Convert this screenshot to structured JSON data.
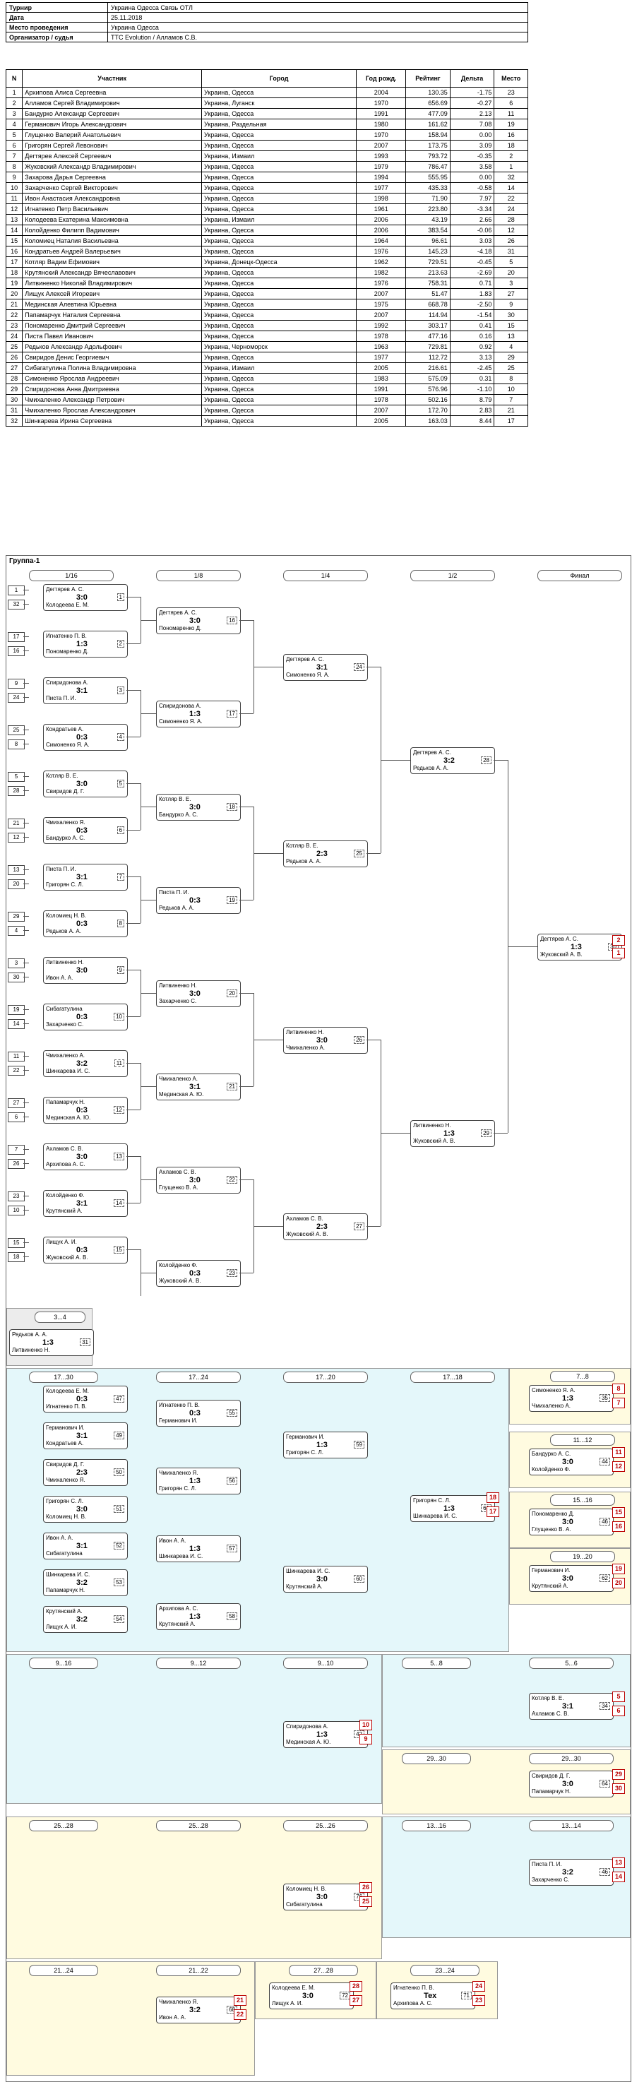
{
  "info": [
    {
      "k": "Турнир",
      "v": "Украина Одесса Связь ОТЛ"
    },
    {
      "k": "Дата",
      "v": "25.11.2018"
    },
    {
      "k": "Место проведения",
      "v": "Украина Одесса"
    },
    {
      "k": "Организатор / судья",
      "v": "TTC Evolution / Алламов С.В."
    }
  ],
  "players_header": [
    "N",
    "Участник",
    "Город",
    "Год рожд.",
    "Рейтинг",
    "Дельта",
    "Место"
  ],
  "players": [
    [
      "1",
      "Архипова Алиса Сергеевна",
      "Украина, Одесса",
      "2004",
      "130.35",
      "-1.75",
      "23"
    ],
    [
      "2",
      "Алламов Сергей Владимирович",
      "Украина, Луганск",
      "1970",
      "656.69",
      "-0.27",
      "6"
    ],
    [
      "3",
      "Бандурко Александр Сергеевич",
      "Украина, Одесса",
      "1991",
      "477.09",
      "2.13",
      "11"
    ],
    [
      "4",
      "Германович Игорь Александрович",
      "Украина, Раздельная",
      "1980",
      "161.62",
      "7.08",
      "19"
    ],
    [
      "5",
      "Глущенко Валерий Анатольевич",
      "Украина, Одесса",
      "1970",
      "158.94",
      "0.00",
      "16"
    ],
    [
      "6",
      "Григорян Сергей Левонович",
      "Украина, Одесса",
      "2007",
      "173.75",
      "3.09",
      "18"
    ],
    [
      "7",
      "Дегтярев Алексей Сергеевич",
      "Украина, Измаил",
      "1993",
      "793.72",
      "-0.35",
      "2"
    ],
    [
      "8",
      "Жуковский Александр Владимирович",
      "Украина, Одесса",
      "1979",
      "786.47",
      "3.58",
      "1"
    ],
    [
      "9",
      "Захарова Дарья Сергеевна",
      "Украина, Одесса",
      "1994",
      "555.95",
      "0.00",
      "32"
    ],
    [
      "10",
      "Захарченко Сергей Викторович",
      "Украина, Одесса",
      "1977",
      "435.33",
      "-0.58",
      "14"
    ],
    [
      "11",
      "Ивон Анастасия Александровна",
      "Украина, Одесса",
      "1998",
      "71.90",
      "7.97",
      "22"
    ],
    [
      "12",
      "Игнатенко Петр Васильевич",
      "Украина, Одесса",
      "1961",
      "223.80",
      "-3.34",
      "24"
    ],
    [
      "13",
      "Колодеева Екатерина Максимовна",
      "Украина, Измаил",
      "2006",
      "43.19",
      "2.66",
      "28"
    ],
    [
      "14",
      "Колойденко Филипп Вадимович",
      "Украина, Одесса",
      "2006",
      "383.54",
      "-0.06",
      "12"
    ],
    [
      "15",
      "Коломиец Наталия Васильевна",
      "Украина, Одесса",
      "1964",
      "96.61",
      "3.03",
      "26"
    ],
    [
      "16",
      "Кондратьев Андрей Валерьевич",
      "Украина, Одесса",
      "1976",
      "145.23",
      "-4.18",
      "31"
    ],
    [
      "17",
      "Котляр Вадим Ефимович",
      "Украина, Донецк-Одесса",
      "1962",
      "729.51",
      "-0.45",
      "5"
    ],
    [
      "18",
      "Крутянский Александр Вячеславович",
      "Украина, Одесса",
      "1982",
      "213.63",
      "-2.69",
      "20"
    ],
    [
      "19",
      "Литвиненко Николай Владимирович",
      "Украина, Одесса",
      "1976",
      "758.31",
      "0.71",
      "3"
    ],
    [
      "20",
      "Лищук Алексей Игоревич",
      "Украина, Одесса",
      "2007",
      "51.47",
      "1.83",
      "27"
    ],
    [
      "21",
      "Мединская Алевтина Юрьевна",
      "Украина, Одесса",
      "1975",
      "668.78",
      "-2.50",
      "9"
    ],
    [
      "22",
      "Папамарчук Наталия Сергеевна",
      "Украина, Одесса",
      "2007",
      "114.94",
      "-1.54",
      "30"
    ],
    [
      "23",
      "Пономаренко Дмитрий Сергеевич",
      "Украина, Одесса",
      "1992",
      "303.17",
      "0.41",
      "15"
    ],
    [
      "24",
      "Писта Павел Иванович",
      "Украина, Одесса",
      "1978",
      "477.16",
      "0.16",
      "13"
    ],
    [
      "25",
      "Редьков Александр Адольфович",
      "Украина, Черноморск",
      "1963",
      "729.81",
      "0.92",
      "4"
    ],
    [
      "26",
      "Свиридов Денис Георгиевич",
      "Украина, Одесса",
      "1977",
      "112.72",
      "3.13",
      "29"
    ],
    [
      "27",
      "Сибагатулина Полина Владимировна",
      "Украина, Измаил",
      "2005",
      "216.61",
      "-2.45",
      "25"
    ],
    [
      "28",
      "Симоненко Ярослав Андреевич",
      "Украина, Одесса",
      "1983",
      "575.09",
      "0.31",
      "8"
    ],
    [
      "29",
      "Спиридонова Анна Дмитриевна",
      "Украина, Одесса",
      "1991",
      "576.96",
      "-1.10",
      "10"
    ],
    [
      "30",
      "Чмихаленко Александр Петрович",
      "Украина, Одесса",
      "1978",
      "502.16",
      "8.79",
      "7"
    ],
    [
      "31",
      "Чмихаленко Ярослав Александрович",
      "Украина, Одесса",
      "2007",
      "172.70",
      "2.83",
      "21"
    ],
    [
      "32",
      "Шинкарева Ирина Сергеевна",
      "Украина, Одесса",
      "2005",
      "163.03",
      "8.44",
      "17"
    ]
  ],
  "group_title": "Группа-1",
  "rounds": [
    "1/16",
    "1/8",
    "1/4",
    "1/2",
    "Финал"
  ],
  "r16": [
    {
      "s1": "1",
      "s2": "32",
      "p1": "Дегтярев А. С.",
      "p2": "Колодеева Е. М.",
      "sc": "3:0",
      "no": "1",
      "out": "-48"
    },
    {
      "s1": "17",
      "s2": "16",
      "p1": "Игнатенко П. В.",
      "p2": "Пономаренко Д.",
      "sc": "1:3",
      "no": "2",
      "out": "-48"
    },
    {
      "s1": "9",
      "s2": "24",
      "p1": "Спиридонова А.",
      "p2": "Писта П. И.",
      "sc": "3:1",
      "no": "3",
      "out": "-49"
    },
    {
      "s1": "25",
      "s2": "8",
      "p1": "Кондратьев А.",
      "p2": "Симоненко Я. А.",
      "sc": "0:3",
      "no": "4",
      "out": "-49"
    },
    {
      "s1": "5",
      "s2": "28",
      "p1": "Котляр В. Е.",
      "p2": "Свиридов Д. Г.",
      "sc": "3:0",
      "no": "5",
      "out": "-50"
    },
    {
      "s1": "21",
      "s2": "12",
      "p1": "Чмихаленко Я.",
      "p2": "Бандурко А. С.",
      "sc": "0:3",
      "no": "6",
      "out": "-50"
    },
    {
      "s1": "13",
      "s2": "20",
      "p1": "Писта П. И.",
      "p2": "Григорян С. Л.",
      "sc": "3:1",
      "no": "7",
      "out": "-51"
    },
    {
      "s1": "29",
      "s2": "4",
      "p1": "Коломиец Н. В.",
      "p2": "Редьков А. А.",
      "sc": "0:3",
      "no": "8",
      "out": "-51"
    },
    {
      "s1": "3",
      "s2": "30",
      "p1": "Литвиненко Н.",
      "p2": "Ивон А. А.",
      "sc": "3:0",
      "no": "9",
      "out": "-52"
    },
    {
      "s1": "19",
      "s2": "14",
      "p1": "Сибагатулина",
      "p2": "Захарченко С.",
      "sc": "0:3",
      "no": "10",
      "out": "-52"
    },
    {
      "s1": "11",
      "s2": "22",
      "p1": "Чмихаленко А.",
      "p2": "Шинкарева И. С.",
      "sc": "3:2",
      "no": "11",
      "out": "-53"
    },
    {
      "s1": "27",
      "s2": "6",
      "p1": "Папамарчук Н.",
      "p2": "Мединская А. Ю.",
      "sc": "0:3",
      "no": "12",
      "out": "-53"
    },
    {
      "s1": "7",
      "s2": "26",
      "p1": "Ахламов С. В.",
      "p2": "Архипова А. С.",
      "sc": "3:0",
      "no": "13",
      "out": "-54"
    },
    {
      "s1": "23",
      "s2": "10",
      "p1": "Колойденко Ф.",
      "p2": "Крутянский А.",
      "sc": "3:1",
      "no": "14",
      "out": "-54"
    },
    {
      "s1": "15",
      "s2": "18",
      "p1": "Лищук А. И.",
      "p2": "Жуковский А. В.",
      "sc": "0:3",
      "no": "15",
      "out": "-55"
    }
  ],
  "r8": [
    {
      "p1": "Дегтярев А. С.",
      "p2": "Пономаренко Д.",
      "sc": "3:0",
      "no": "16",
      "out": "-36"
    },
    {
      "p1": "Спиридонова А.",
      "p2": "Симоненко Я. А.",
      "sc": "1:3",
      "no": "17",
      "out": "-36"
    },
    {
      "p1": "Котляр В. Е.",
      "p2": "Бандурко А. С.",
      "sc": "3:0",
      "no": "18",
      "out": "-37"
    },
    {
      "p1": "Писта П. И.",
      "p2": "Редьков А. А.",
      "sc": "0:3",
      "no": "19",
      "out": "-37"
    },
    {
      "p1": "Литвиненко Н.",
      "p2": "Захарченко С.",
      "sc": "3:0",
      "no": "20",
      "out": "-38"
    },
    {
      "p1": "Чмихаленко А.",
      "p2": "Мединская А. Ю.",
      "sc": "3:1",
      "no": "21",
      "out": "-38"
    },
    {
      "p1": "Ахламов С. В.",
      "p2": "Глущенко В. А.",
      "sc": "3:0",
      "no": "22",
      "out": "-39"
    },
    {
      "p1": "Колойденко Ф.",
      "p2": "Жуковский А. В.",
      "sc": "0:3",
      "no": "23",
      "out": "-39"
    }
  ],
  "r4": [
    {
      "p1": "Дегтярев А. С.",
      "p2": "Симоненко Я. А.",
      "sc": "3:1",
      "no": "24",
      "out": "-32"
    },
    {
      "p1": "Котляр В. Е.",
      "p2": "Редьков А. А.",
      "sc": "2:3",
      "no": "25",
      "out": "-32"
    },
    {
      "p1": "Литвиненко Н.",
      "p2": "Чмихаленко А.",
      "sc": "3:0",
      "no": "26",
      "out": "-33"
    },
    {
      "p1": "Ахламов С. В.",
      "p2": "Жуковский А. В.",
      "sc": "2:3",
      "no": "27",
      "out": "-33"
    }
  ],
  "r2": [
    {
      "p1": "Дегтярев А. С.",
      "p2": "Редьков А. А.",
      "sc": "3:2",
      "no": "28",
      "out": "-31"
    },
    {
      "p1": "Литвиненко Н.",
      "p2": "Жуковский А. В.",
      "sc": "1:3",
      "no": "29",
      "out": "-31"
    }
  ],
  "final": {
    "p1": "Дегтярев А. С.",
    "p2": "Жуковский А. В.",
    "sc": "1:3",
    "no": "30",
    "pl1": "2",
    "pl2": "1"
  },
  "third": {
    "title": "3...4",
    "p1": "Редьков А. А.",
    "p2": "Литвиненко Н.",
    "sc": "1:3",
    "no": "31",
    "s1": "-28",
    "s2": "-29",
    "pl1": "4",
    "pl2": "3"
  },
  "cons": {
    "r_17_32": "17...30",
    "r_17_24": "17...24",
    "r_17_20": "17...20",
    "r_17_18": "17...18",
    "r_7_8": "7...8",
    "r_11_12": "11...12",
    "r_15_16": "15...16",
    "r_19_20": "19...20",
    "r_9_16": "9...16",
    "r_9_12": "9...12",
    "r_9_10": "9...10",
    "r_5_8": "5...8",
    "r_5_6": "5...6",
    "r_29_30": "29...30",
    "r_25_28": "25...28",
    "r_25_26": "25...26",
    "r_13_16": "13...16",
    "r_13_14": "13...14",
    "r_21_24": "21...24",
    "r_21_22": "21...22",
    "r_27_28": "27...28",
    "r_23_24": "23...24",
    "a": [
      {
        "p1": "Колодеева Е. М.",
        "p2": "Игнатенко П. В.",
        "sc": "0:3",
        "no": "47"
      },
      {
        "p1": "Германович И.",
        "p2": "Кондратьев А.",
        "sc": "3:1",
        "no": "49"
      },
      {
        "p1": "Свиридов Д. Г.",
        "p2": "Чмихаленко Я.",
        "sc": "2:3",
        "no": "50"
      },
      {
        "p1": "Григорян С. Л.",
        "p2": "Коломиец Н. В.",
        "sc": "3:0",
        "no": "51"
      },
      {
        "p1": "Ивон А. А.",
        "p2": "Сибагатулина",
        "sc": "3:1",
        "no": "52"
      },
      {
        "p1": "Шинкарева И. С.",
        "p2": "Папамарчук Н.",
        "sc": "3:2",
        "no": "53"
      },
      {
        "p1": "Крутянский А.",
        "p2": "Лищук А. И.",
        "sc": "3:2",
        "no": "54"
      }
    ],
    "b": [
      {
        "p1": "Игнатенко П. В.",
        "p2": "Германович И.",
        "sc": "0:3",
        "no": "55"
      },
      {
        "p1": "Чмихаленко Я.",
        "p2": "Григорян С. Л.",
        "sc": "1:3",
        "no": "56"
      },
      {
        "p1": "Ивон А. А.",
        "p2": "Шинкарева И. С.",
        "sc": "1:3",
        "no": "57"
      },
      {
        "p1": "Архипова А. С.",
        "p2": "Крутянский А.",
        "sc": "1:3",
        "no": "58"
      }
    ],
    "c": [
      {
        "p1": "Германович И.",
        "p2": "Григорян С. Л.",
        "sc": "1:3",
        "no": "59"
      },
      {
        "p1": "Шинкарева И. С.",
        "p2": "Крутянский А.",
        "sc": "3:0",
        "no": "60"
      }
    ],
    "d": {
      "p1": "Григорян С. Л.",
      "p2": "Шинкарева И. С.",
      "sc": "1:3",
      "no": "61",
      "pl1": "18",
      "pl2": "17"
    },
    "pl78": {
      "p1": "Симоненко Я. А.",
      "p2": "Чмихаленко А.",
      "sc": "1:3",
      "no": "35",
      "pl1": "8",
      "pl2": "7"
    },
    "pl1112": {
      "p1": "Бандурко А. С.",
      "p2": "Колойденко Ф.",
      "sc": "3:0",
      "no": "44",
      "pl1": "11",
      "pl2": "12"
    },
    "pl1516": {
      "p1": "Пономаренко Д.",
      "p2": "Глущенко В. А.",
      "sc": "3:0",
      "no": "46",
      "pl1": "15",
      "pl2": "16"
    },
    "pl1920": {
      "p1": "Германович И.",
      "p2": "Крутянский А.",
      "sc": "3:0",
      "no": "62",
      "pl1": "19",
      "pl2": "20"
    }
  },
  "bottom": {
    "m910": {
      "p1": "Спиридонова А.",
      "p2": "Мединская А. Ю.",
      "sc": "1:3",
      "no": "42",
      "pl1": "10",
      "pl2": "9"
    },
    "m56": {
      "p1": "Котляр В. Е.",
      "p2": "Ахламов С. В.",
      "sc": "3:1",
      "no": "34",
      "pl1": "5",
      "pl2": "6"
    },
    "m2930": {
      "p1": "Свиридов Д. Г.",
      "p2": "Папамарчук Н.",
      "sc": "3:0",
      "no": "64",
      "pl1": "29",
      "pl2": "30"
    },
    "m2526": {
      "p1": "Коломиец Н. В.",
      "p2": "Сибагатулина",
      "sc": "3:0",
      "no": "76",
      "pl1": "26",
      "pl2": "25"
    },
    "m1314": {
      "p1": "Писта П. И.",
      "p2": "Захарченко С.",
      "sc": "3:2",
      "no": "46",
      "pl1": "13",
      "pl2": "14"
    },
    "m2122": {
      "p1": "Чмихаленко Я.",
      "p2": "Ивон А. А.",
      "sc": "3:2",
      "no": "68",
      "pl1": "21",
      "pl2": "22"
    },
    "m2728": {
      "p1": "Колодеева Е. М.",
      "p2": "Лищук А. И.",
      "sc": "3:0",
      "no": "72",
      "pl1": "28",
      "pl2": "27"
    },
    "m2324": {
      "p1": "Игнатенко П. В.",
      "p2": "Архипова А. С.",
      "sc": "Тех",
      "no": "71",
      "pl1": "24",
      "pl2": "23"
    }
  }
}
